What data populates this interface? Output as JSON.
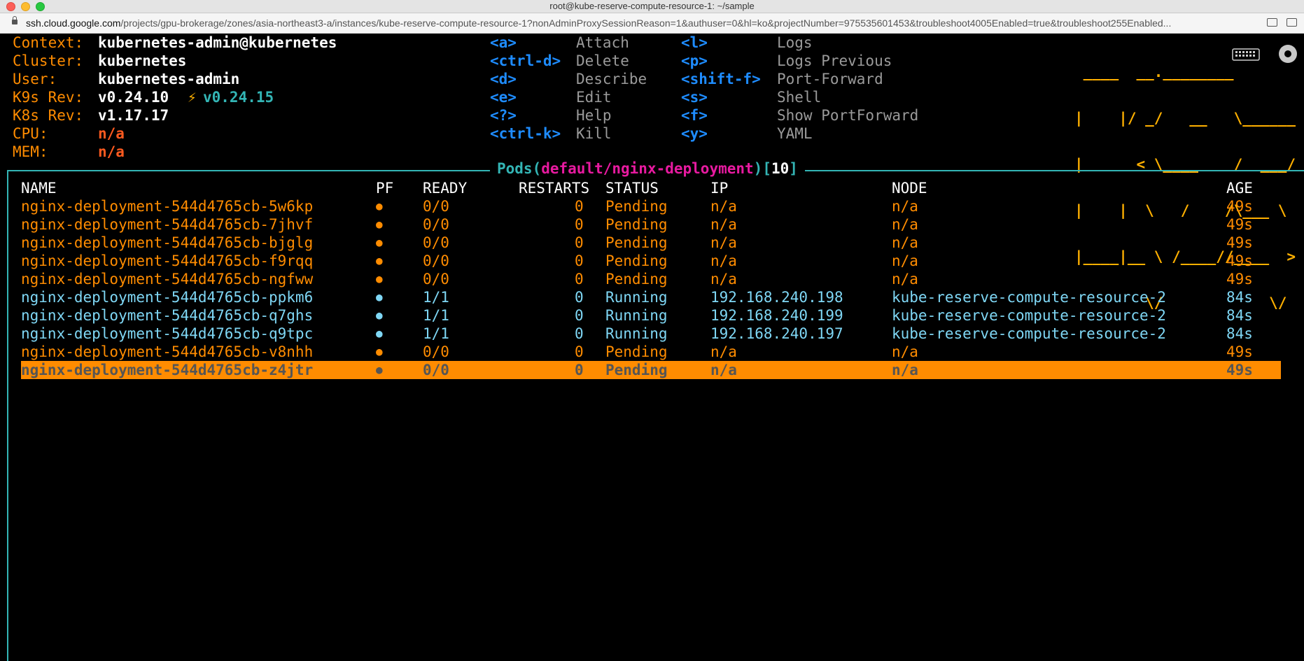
{
  "window": {
    "title": "root@kube-reserve-compute-resource-1: ~/sample"
  },
  "browser": {
    "url_host": "ssh.cloud.google.com",
    "url_path": "/projects/gpu-brokerage/zones/asia-northeast3-a/instances/kube-reserve-compute-resource-1?nonAdminProxySessionReason=1&authuser=0&hl=ko&projectNumber=975535601453&troubleshoot4005Enabled=true&troubleshoot255Enabled..."
  },
  "info": {
    "context_label": "Context:",
    "context_value": "kubernetes-admin@kubernetes",
    "cluster_label": "Cluster:",
    "cluster_value": "kubernetes",
    "user_label": "User:",
    "user_value": "kubernetes-admin",
    "k9s_label": "K9s Rev:",
    "k9s_value": "v0.24.10",
    "k9s_upgrade": "v0.24.15",
    "k8s_label": "K8s Rev:",
    "k8s_value": "v1.17.17",
    "cpu_label": "CPU:",
    "cpu_value": "n/a",
    "mem_label": "MEM:",
    "mem_value": "n/a"
  },
  "hotkeys_col1": [
    {
      "key": "<a>",
      "desc": "Attach"
    },
    {
      "key": "<ctrl-d>",
      "desc": "Delete"
    },
    {
      "key": "<d>",
      "desc": "Describe"
    },
    {
      "key": "<e>",
      "desc": "Edit"
    },
    {
      "key": "<?>",
      "desc": "Help"
    },
    {
      "key": "<ctrl-k>",
      "desc": "Kill"
    }
  ],
  "hotkeys_col2": [
    {
      "key": "<l>",
      "desc": "Logs"
    },
    {
      "key": "<p>",
      "desc": "Logs Previous"
    },
    {
      "key": "<shift-f>",
      "desc": "Port-Forward"
    },
    {
      "key": "<s>",
      "desc": "Shell"
    },
    {
      "key": "<f>",
      "desc": "Show PortForward"
    },
    {
      "key": "<y>",
      "desc": "YAML"
    }
  ],
  "logo_lines": [
    " ____  __.________       ",
    "|    |/ _/   __   \\______",
    "|      < \\____    /  ___/",
    "|    |  \\   /    /\\___ \\ ",
    "|____|__ \\ /____//____  >",
    "        \\/            \\/ "
  ],
  "panel": {
    "resource": "Pods",
    "open": "(",
    "scope": "default/nginx-deployment",
    "close": ")",
    "count_open": "[",
    "count": "10",
    "count_close": "]"
  },
  "table": {
    "headers": {
      "name": "NAME",
      "pf": "PF",
      "ready": "READY",
      "restarts": "RESTARTS",
      "status": "STATUS",
      "ip": "IP",
      "node": "NODE",
      "age": "AGE"
    },
    "rows": [
      {
        "name": "nginx-deployment-544d4765cb-5w6kp",
        "pf": "●",
        "ready": "0/0",
        "restarts": "0",
        "status": "Pending",
        "ip": "n/a",
        "node": "n/a",
        "age": "49s"
      },
      {
        "name": "nginx-deployment-544d4765cb-7jhvf",
        "pf": "●",
        "ready": "0/0",
        "restarts": "0",
        "status": "Pending",
        "ip": "n/a",
        "node": "n/a",
        "age": "49s"
      },
      {
        "name": "nginx-deployment-544d4765cb-bjglg",
        "pf": "●",
        "ready": "0/0",
        "restarts": "0",
        "status": "Pending",
        "ip": "n/a",
        "node": "n/a",
        "age": "49s"
      },
      {
        "name": "nginx-deployment-544d4765cb-f9rqq",
        "pf": "●",
        "ready": "0/0",
        "restarts": "0",
        "status": "Pending",
        "ip": "n/a",
        "node": "n/a",
        "age": "49s"
      },
      {
        "name": "nginx-deployment-544d4765cb-ngfww",
        "pf": "●",
        "ready": "0/0",
        "restarts": "0",
        "status": "Pending",
        "ip": "n/a",
        "node": "n/a",
        "age": "49s"
      },
      {
        "name": "nginx-deployment-544d4765cb-ppkm6",
        "pf": "●",
        "ready": "1/1",
        "restarts": "0",
        "status": "Running",
        "ip": "192.168.240.198",
        "node": "kube-reserve-compute-resource-2",
        "age": "84s"
      },
      {
        "name": "nginx-deployment-544d4765cb-q7ghs",
        "pf": "●",
        "ready": "1/1",
        "restarts": "0",
        "status": "Running",
        "ip": "192.168.240.199",
        "node": "kube-reserve-compute-resource-2",
        "age": "84s"
      },
      {
        "name": "nginx-deployment-544d4765cb-q9tpc",
        "pf": "●",
        "ready": "1/1",
        "restarts": "0",
        "status": "Running",
        "ip": "192.168.240.197",
        "node": "kube-reserve-compute-resource-2",
        "age": "84s"
      },
      {
        "name": "nginx-deployment-544d4765cb-v8nhh",
        "pf": "●",
        "ready": "0/0",
        "restarts": "0",
        "status": "Pending",
        "ip": "n/a",
        "node": "n/a",
        "age": "49s"
      },
      {
        "name": "nginx-deployment-544d4765cb-z4jtr",
        "pf": "●",
        "ready": "0/0",
        "restarts": "0",
        "status": "Pending",
        "ip": "n/a",
        "node": "n/a",
        "age": "49s"
      }
    ],
    "selected_index": 9
  },
  "colors": {
    "pending": "#ff8c00",
    "running": "#7fd7f5",
    "frame": "#33b5b5",
    "key": "#1e8cff",
    "scope": "#e81aa0"
  }
}
